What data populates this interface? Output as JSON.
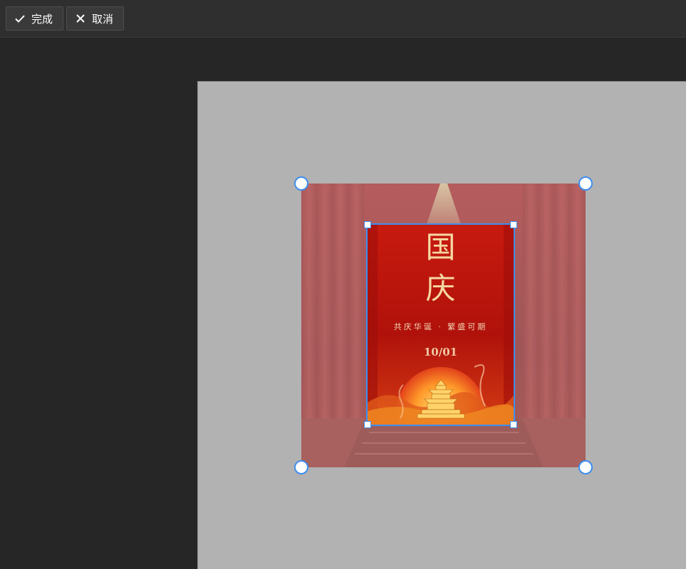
{
  "toolbar": {
    "done_label": "完成",
    "cancel_label": "取消",
    "done_icon": "check-icon",
    "cancel_icon": "close-icon"
  },
  "poster": {
    "title_line1": "国",
    "title_line2": "庆",
    "subtitle": "共庆华诞 · 繁盛可期",
    "date": "10/01"
  },
  "colors": {
    "accent": "#3d8ef0",
    "toolbar_bg": "#2f2f2f",
    "workspace_bg": "#262626",
    "artboard_bg": "#b2b2b2",
    "poster_red": "#c4160c",
    "poster_gold": "#f6d7a3"
  }
}
